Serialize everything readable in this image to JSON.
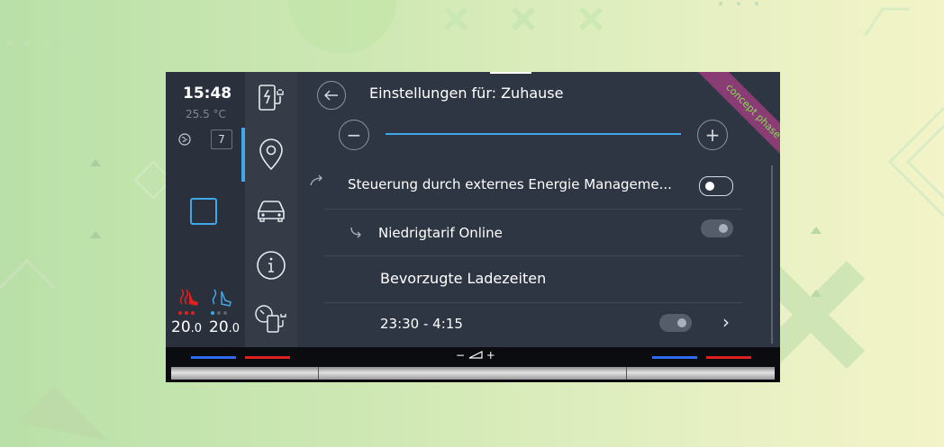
{
  "status": {
    "time": "15:48",
    "outside_temp": "25.5 °C",
    "badge_number": "7"
  },
  "climate": {
    "left_temp_main": "20",
    "left_temp_decimal": ".0",
    "right_temp_main": "20",
    "right_temp_decimal": ".0"
  },
  "header": {
    "title": "Einstellungen für: Zuhause",
    "minus": "−",
    "plus": "+"
  },
  "rows": [
    {
      "label": "Steuerung durch externes Energie Manageme...",
      "toggle": "on"
    },
    {
      "label": "Niedrigtarif Online",
      "toggle": "dim"
    },
    {
      "label": "Bevorzugte Ladezeiten"
    },
    {
      "label": "23:30 - 4:15",
      "toggle": "dim",
      "chevron": "›"
    }
  ],
  "ribbon": {
    "text": "concept phase"
  },
  "bottom": {
    "volume_minus": "−",
    "volume_plus": "+"
  },
  "colors": {
    "accent": "#3ea8e8",
    "ribbon_bg": "#8a3d74",
    "ribbon_text": "#7ee04f",
    "heat_red": "#e02020",
    "cool_blue": "#2d6cf0"
  },
  "icons": {
    "charging": "ev-charging-icon",
    "location": "location-pin-icon",
    "car": "car-icon",
    "info": "info-icon",
    "charge_timer": "charge-timer-icon"
  }
}
